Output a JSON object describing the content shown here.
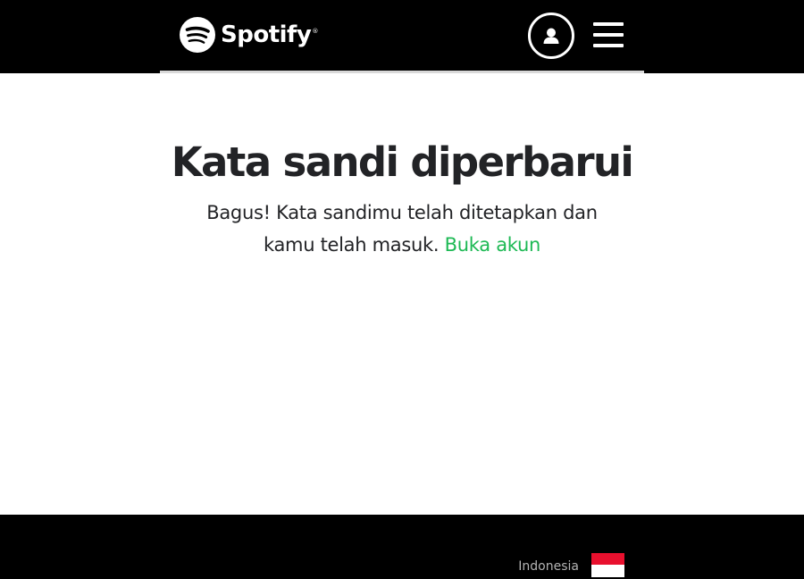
{
  "header": {
    "logo_text": "Spotify",
    "logo_icon": "spotify-logo-icon",
    "profile_icon": "user-icon",
    "menu_icon": "hamburger-menu-icon"
  },
  "main": {
    "heading": "Kata sandi diperbarui",
    "message_text": "Bagus! Kata sandimu telah ditetapkan dan kamu telah masuk.",
    "link_text": "Buka akun"
  },
  "footer": {
    "country": "Indonesia",
    "flag_icon": "indonesia-flag-icon"
  },
  "colors": {
    "header_bg": "#000000",
    "footer_bg": "#000000",
    "text": "#222326",
    "link": "#1db954",
    "flag_red": "#e8102e"
  }
}
